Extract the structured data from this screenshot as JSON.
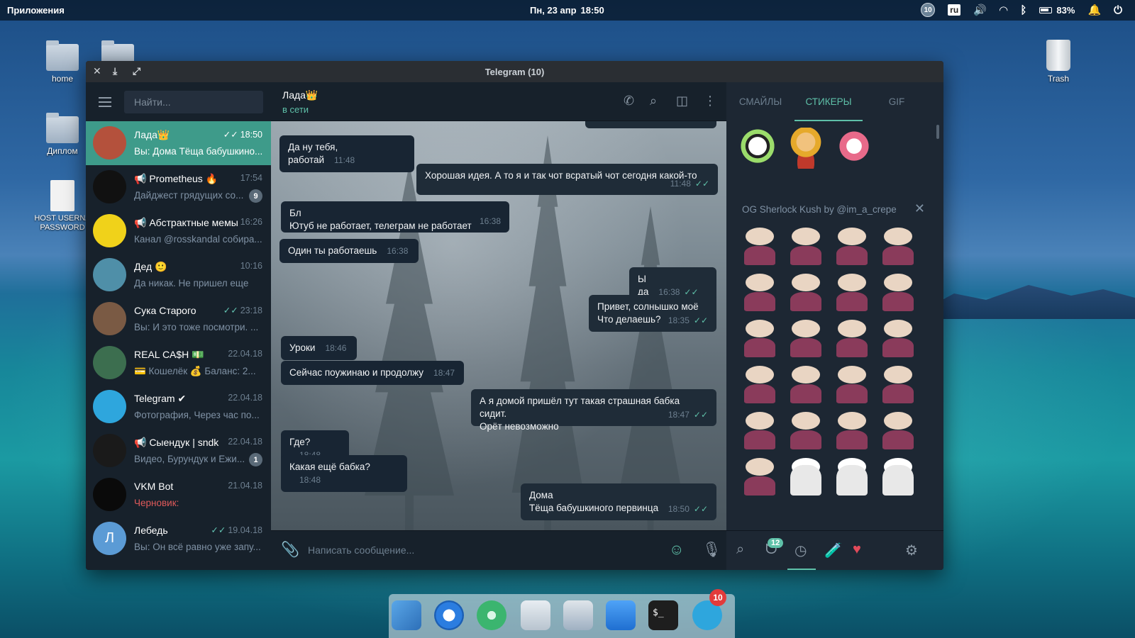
{
  "panel": {
    "apps": "Приложения",
    "date": "Пн, 23 апр",
    "time": "18:50",
    "notif_count": "10",
    "lang": "ru",
    "battery": "83%"
  },
  "desktop": {
    "icons": [
      "home",
      "Диплом",
      "HOST USERNA PASSWORD",
      "Trash"
    ]
  },
  "window": {
    "title": "Telegram (10)"
  },
  "sidebar": {
    "search_placeholder": "Найти...",
    "chats": [
      {
        "name": "Лада👑",
        "time": "18:50",
        "preview": "Вы: Дома Тёща бабушкино...",
        "read": true,
        "active": true,
        "color": "#b4513c"
      },
      {
        "name": "📢 Prometheus 🔥",
        "time": "17:54",
        "preview": "Дайджест грядущих со...",
        "count": "9",
        "color": "#111111"
      },
      {
        "name": "📢 Абстрактные мемы",
        "time": "16:26",
        "preview": "Канал @rosskandal собира...",
        "color": "#f0d21a"
      },
      {
        "name": "Дед 🙂",
        "time": "10:16",
        "preview": "Да никак. Не пришел еще",
        "color": "#4f8fa8"
      },
      {
        "name": "Сука Старого",
        "time": "23:18",
        "preview": "Вы: И это тоже посмотри. ...",
        "read": true,
        "color": "#7a5a44"
      },
      {
        "name": "REAL CA$H 💵",
        "time": "22.04.18",
        "preview": "💳 Кошелёк 💰 Баланс: 2...",
        "color": "#3c6e4f"
      },
      {
        "name": "Telegram ✔",
        "time": "22.04.18",
        "preview": "Фотография, Через час по...",
        "color": "#2ea6dd"
      },
      {
        "name": "📢 Сыендук | sndk",
        "time": "22.04.18",
        "preview": "Видео, Бурундук и Ежи...",
        "count": "1",
        "color": "#1a1a1a"
      },
      {
        "name": "VKM Bot",
        "time": "21.04.18",
        "preview": "Черновик:",
        "draft": true,
        "color": "#0a0a0a"
      },
      {
        "name": "Лебедь",
        "time": "19.04.18",
        "preview": "Вы: Он всё равно уже запу...",
        "read": true,
        "initial": "Л",
        "color": "#5b9bd5"
      }
    ]
  },
  "chat_header": {
    "name": "Лада👑",
    "status": "в сети"
  },
  "messages": [
    {
      "text": "Да ну тебя, работай",
      "time": "11:48",
      "out": false
    },
    {
      "text": "Хорошая идея. А то я и так чот всратый чот сегодня какой-то",
      "time": "11:48",
      "out": true
    },
    {
      "text": "Бл\nЮтуб не работает, телеграм не работает",
      "time": "16:38",
      "out": false
    },
    {
      "text": "Один ты работаешь",
      "time": "16:38",
      "out": false
    },
    {
      "text": "Ы да",
      "time": "16:38",
      "out": true
    },
    {
      "text": "Привет, солнышко моё\nЧто делаешь?",
      "time": "18:35",
      "out": true
    },
    {
      "text": "Уроки",
      "time": "18:46",
      "out": false
    },
    {
      "text": "Сейчас поужинаю и продолжу",
      "time": "18:47",
      "out": false
    },
    {
      "text": "А я домой пришёл тут такая страшная бабка сидит.\nОрёт невозможно",
      "time": "18:47",
      "out": true
    },
    {
      "text": "Где?",
      "time": "18:48",
      "out": false
    },
    {
      "text": "Какая ещё бабка?",
      "time": "18:48",
      "out": false
    },
    {
      "text": "Дома\nТёща бабушкиного первинца",
      "time": "18:50",
      "out": true
    }
  ],
  "composer": {
    "placeholder": "Написать сообщение..."
  },
  "stickers": {
    "tabs": [
      "СМАЙЛЫ",
      "СТИКЕРЫ",
      "GIF"
    ],
    "active_tab": "СТИКЕРЫ",
    "set_name": "OG Sherlock Kush by @im_a_crepe",
    "recent_badge": "12"
  },
  "dock": {
    "telegram_badge": "10"
  },
  "colors": {
    "accent": "#5fc1a9",
    "bg": "#17212b",
    "active_chat": "#3e9b8a"
  }
}
